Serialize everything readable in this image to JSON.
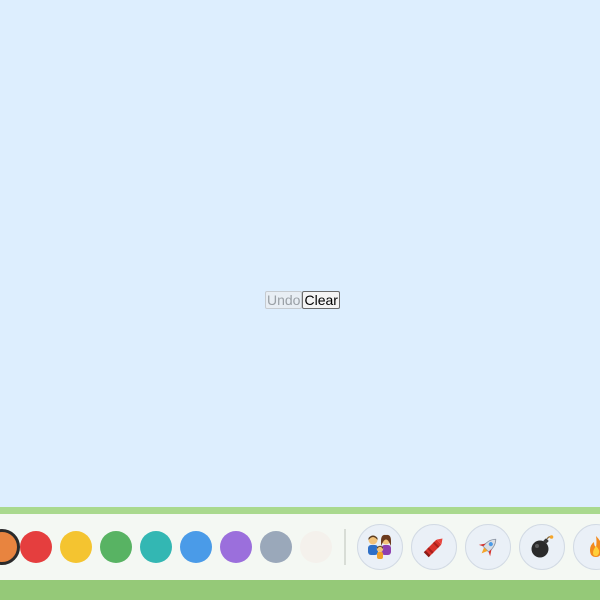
{
  "controls": {
    "undo_label": "Undo",
    "clear_label": "Clear"
  },
  "palette": {
    "colors": [
      {
        "name": "orange",
        "hex": "#e8843f",
        "selected": true
      },
      {
        "name": "red",
        "hex": "#e53e3e",
        "selected": false
      },
      {
        "name": "yellow",
        "hex": "#f4c430",
        "selected": false
      },
      {
        "name": "green",
        "hex": "#58b363",
        "selected": false
      },
      {
        "name": "teal",
        "hex": "#33b7b3",
        "selected": false
      },
      {
        "name": "blue",
        "hex": "#4a9be8",
        "selected": false
      },
      {
        "name": "purple",
        "hex": "#9b6fdc",
        "selected": false
      },
      {
        "name": "gray",
        "hex": "#9aa8ba",
        "selected": false
      },
      {
        "name": "white",
        "hex": "#f4f1ec",
        "selected": false
      }
    ]
  },
  "stamps": [
    {
      "icon": "family-icon"
    },
    {
      "icon": "crayon-icon"
    },
    {
      "icon": "rocket-icon"
    },
    {
      "icon": "bomb-icon"
    },
    {
      "icon": "fire-icon"
    }
  ],
  "theme": {
    "canvas_bg": "#ddeefe",
    "toolbar_bg": "#f4f8f3",
    "toolbar_top_strip": "#a9d98e",
    "toolbar_bottom_strip": "#95c978"
  }
}
